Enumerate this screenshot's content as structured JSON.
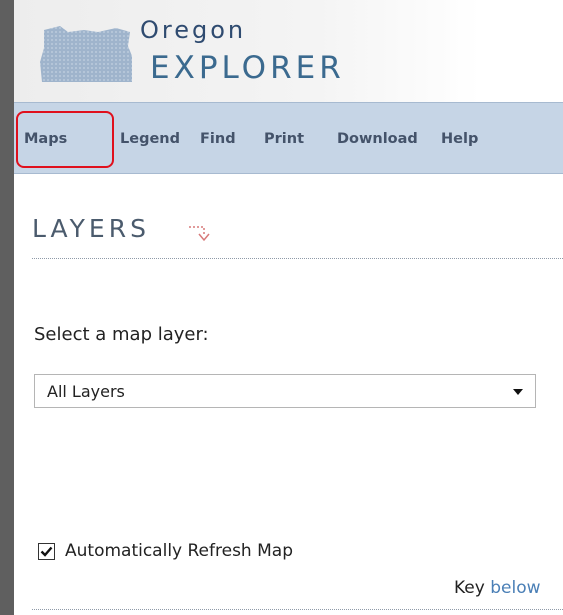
{
  "header": {
    "logo_line1": "Oregon",
    "logo_line2": "EXPLORER"
  },
  "nav": {
    "active": "Maps",
    "items": [
      {
        "label": "Maps"
      },
      {
        "label": "Legend"
      },
      {
        "label": "Find"
      },
      {
        "label": "Print"
      },
      {
        "label": "Download"
      },
      {
        "label": "Help"
      }
    ]
  },
  "layers": {
    "title": "LAYERS",
    "title_icon": "dotted-arrow-down-icon",
    "select_label": "Select a map layer:",
    "select_value": "All Layers",
    "auto_refresh_label": "Automatically Refresh Map",
    "auto_refresh_checked": true,
    "key_text": "Key",
    "key_link": "below"
  },
  "colors": {
    "background": "#5f5f5f",
    "nav_bar": "#c6d5e6",
    "nav_text": "#44536a",
    "highlight": "#e0101d",
    "logo_text": "#2f4b70",
    "link": "#4a7fb6"
  }
}
